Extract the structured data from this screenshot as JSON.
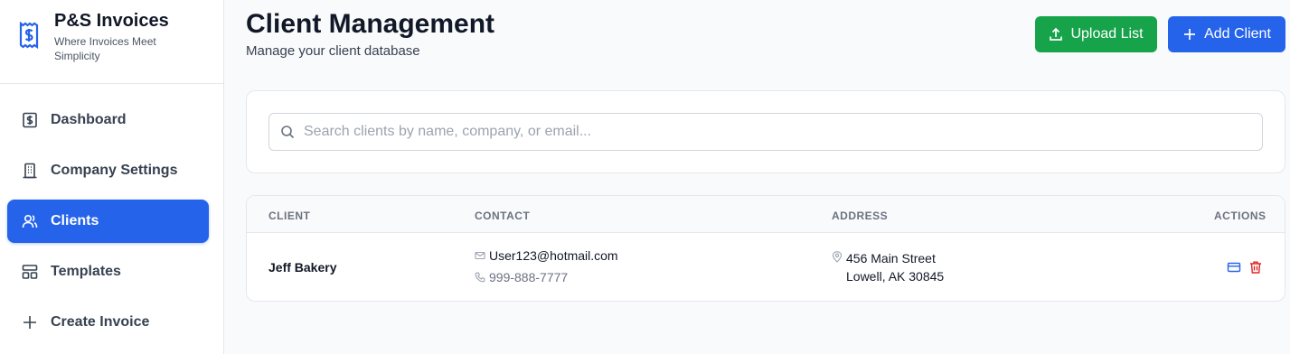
{
  "brand": {
    "name": "P&S Invoices",
    "tagline": "Where Invoices Meet Simplicity"
  },
  "sidebar": {
    "items": [
      {
        "label": "Dashboard",
        "icon": "dollar-receipt-icon",
        "active": false
      },
      {
        "label": "Company Settings",
        "icon": "building-icon",
        "active": false
      },
      {
        "label": "Clients",
        "icon": "users-icon",
        "active": true
      },
      {
        "label": "Templates",
        "icon": "layout-icon",
        "active": false
      },
      {
        "label": "Create Invoice",
        "icon": "plus-icon",
        "active": false
      }
    ]
  },
  "header": {
    "title": "Client Management",
    "subtitle": "Manage your client database",
    "upload_label": "Upload List",
    "add_label": "Add Client"
  },
  "search": {
    "placeholder": "Search clients by name, company, or email...",
    "value": ""
  },
  "table": {
    "columns": {
      "client": "CLIENT",
      "contact": "CONTACT",
      "address": "ADDRESS",
      "actions": "ACTIONS"
    },
    "rows": [
      {
        "client": "Jeff Bakery",
        "email": "User123@hotmail.com",
        "phone": "999-888-7777",
        "address_line1": "456 Main Street",
        "address_line2": "Lowell, AK 30845"
      }
    ]
  },
  "colors": {
    "primary": "#2563eb",
    "success": "#16a34a",
    "danger": "#dc2626"
  }
}
